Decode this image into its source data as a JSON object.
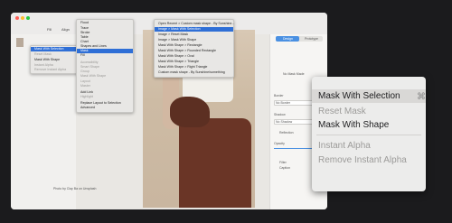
{
  "title_bar": {
    "left_item": "Fill",
    "left_item2": "Align"
  },
  "left_panel": {
    "thumb_label": ""
  },
  "canvas": {
    "photo_credit": "Photo by Clay Ba on Unsplash"
  },
  "right_panel": {
    "tab_1": "Design",
    "tab_2": "Prototype",
    "heading": "No Mask Made",
    "border_label": "Border",
    "border_value": "No Border",
    "shadow_label": "Shadow",
    "shadow_value": "No Shadow",
    "reflection_label": "Reflection",
    "opacity_label": "Opacity",
    "filter_label": "Filter",
    "caption_label": "Caption"
  },
  "menu_left": {
    "items": [
      "Mask With Selection",
      "Reset Mask",
      "Mask With Shape",
      "Instant Alpha",
      "Remove Instant Alpha"
    ]
  },
  "menu_middle": {
    "items": [
      "Flood",
      "Trace",
      "Stroke",
      "Table",
      "Chart",
      "Shapes and Lines",
      "Mask",
      "Fill",
      "Accessibility",
      "Smart Shape",
      "Group",
      "Mask With Shape",
      "Layout",
      "Master",
      "Add Link",
      "Highlight",
      "Replace Layout to Selection",
      "Advanced"
    ]
  },
  "menu_right": {
    "items": [
      "Open Recent > Custom mask shape - By Sunshine...",
      "Image > Mask With Selection",
      "Image > Reset Mask",
      "Image > Mask With Shape",
      "Mask With Shape > Rectangle",
      "Mask With Shape > Rounded Rectangle",
      "Mask With Shape > Oval",
      "Mask With Shape > Triangle",
      "Mask With Shape > Right Triangle",
      "Custom mask shape - By Sunshine/something"
    ]
  },
  "zoom_callout": {
    "items": [
      {
        "label": "Mask With Selection",
        "disabled": false
      },
      {
        "label": "Reset Mask",
        "disabled": true
      },
      {
        "label": "Mask With Shape",
        "disabled": false
      },
      {
        "label": "Instant Alpha",
        "disabled": true
      },
      {
        "label": "Remove Instant Alpha",
        "disabled": true
      }
    ],
    "shortcut": "⌘"
  },
  "colors": {
    "highlight": "#2f6fd6",
    "background": "#1b1b1d"
  }
}
